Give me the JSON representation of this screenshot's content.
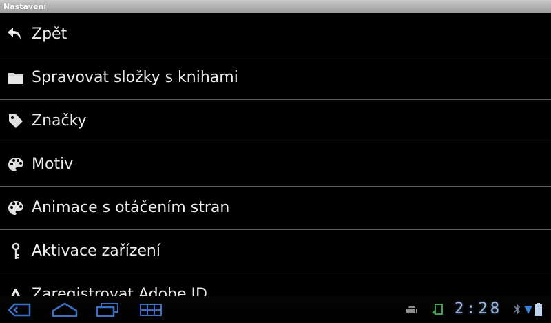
{
  "window": {
    "title": "Nastavení"
  },
  "menu": {
    "items": [
      {
        "label": "Zpět",
        "icon": "back-arrow-icon"
      },
      {
        "label": "Spravovat složky s knihami",
        "icon": "folder-icon"
      },
      {
        "label": "Značky",
        "icon": "tag-icon"
      },
      {
        "label": "Motiv",
        "icon": "palette-icon"
      },
      {
        "label": "Animace s otáčením stran",
        "icon": "palette-icon"
      },
      {
        "label": "Aktivace zařízení",
        "icon": "key-icon"
      },
      {
        "label": "Zaregistrovat Adobe ID",
        "icon": "adobe-icon"
      }
    ]
  },
  "statusbar": {
    "time": "2:28",
    "icons": [
      "android-debug-icon",
      "screen-rotation-icon",
      "bluetooth-icon",
      "wifi-icon",
      "battery-icon"
    ]
  },
  "navbar": {
    "buttons": [
      "back-button",
      "home-button",
      "recent-apps-button",
      "menu-grid-button"
    ]
  },
  "colors": {
    "background": "#000000",
    "text": "#ececec",
    "divider": "#5f5f5f",
    "titlebar": "#b0b0b0",
    "clock": "#9fb6d6"
  }
}
